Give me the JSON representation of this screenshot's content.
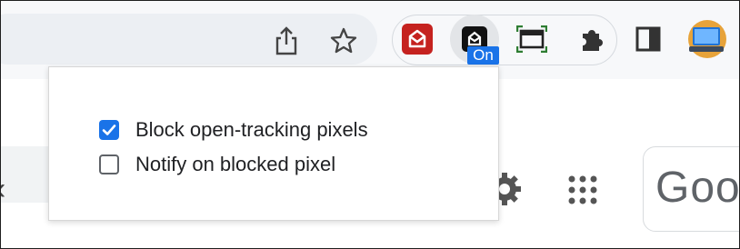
{
  "toolbar": {
    "icons": [
      "share-icon",
      "bookmark-star-icon"
    ],
    "extensions": [
      "gmail-extension-icon",
      "pixel-blocker-extension-icon",
      "screenshot-extension-icon",
      "extensions-puzzle-icon"
    ],
    "active_extension_badge": "On",
    "side_panel_icon": "side-panel-icon",
    "profile_icon": "profile-avatar",
    "accent": "#1a73e8",
    "extension_red": "#c5221f"
  },
  "popup": {
    "options": [
      {
        "label": "Block open-tracking pixels",
        "checked": true
      },
      {
        "label": "Notify on blocked pixel",
        "checked": false
      }
    ]
  },
  "page": {
    "brand_partial": "Goo"
  }
}
